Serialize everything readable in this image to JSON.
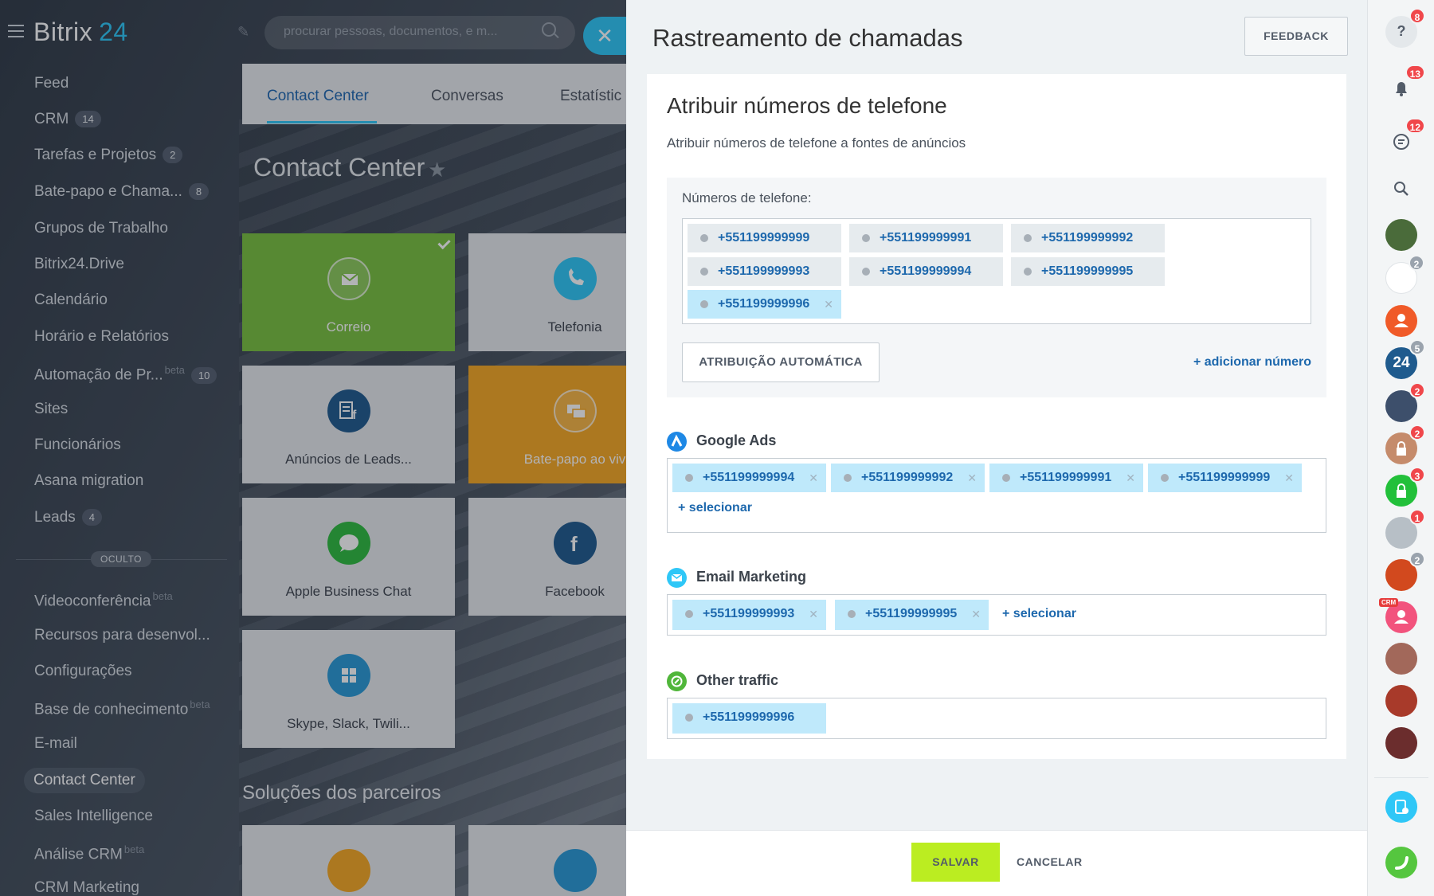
{
  "app": {
    "logo_word": "Bitrix",
    "logo_num": "24"
  },
  "search": {
    "placeholder": "procurar pessoas, documentos, e m..."
  },
  "sidebar": {
    "items": [
      {
        "label": "Feed"
      },
      {
        "label": "CRM",
        "badge": "14"
      },
      {
        "label": "Tarefas e Projetos",
        "badge": "2"
      },
      {
        "label": "Bate-papo e Chama...",
        "badge": "8"
      },
      {
        "label": "Grupos de Trabalho"
      },
      {
        "label": "Bitrix24.Drive"
      },
      {
        "label": "Calendário"
      },
      {
        "label": "Horário e Relatórios"
      },
      {
        "label": "Automação de Pr...",
        "sup": "beta",
        "badge": "10"
      },
      {
        "label": "Sites"
      },
      {
        "label": "Funcionários"
      },
      {
        "label": "Asana migration"
      },
      {
        "label": "Leads",
        "badge": "4"
      }
    ],
    "hidden_label": "OCULTO",
    "hidden_items": [
      {
        "label": "Videoconferência",
        "sup": "beta"
      },
      {
        "label": "Recursos para desenvol..."
      },
      {
        "label": "Configurações"
      },
      {
        "label": "Base de conhecimento",
        "sup": "beta"
      },
      {
        "label": "E-mail"
      },
      {
        "label": "Contact Center",
        "active": true
      },
      {
        "label": "Sales Intelligence"
      },
      {
        "label": "Análise CRM",
        "sup": "beta"
      },
      {
        "label": "CRM Marketing"
      }
    ]
  },
  "contact_center": {
    "tabs": [
      "Contact Center",
      "Conversas",
      "Estatístic"
    ],
    "title": "Contact Center",
    "tiles": [
      {
        "label": "Correio",
        "style": "green",
        "icon": "mail-icon"
      },
      {
        "label": "Telefonia",
        "style": "plain",
        "icon": "phone-icon",
        "color": "#2fc7f7"
      },
      {
        "label": "Anúncios de Leads...",
        "style": "plain",
        "icon": "facebook-leads-icon",
        "color": "#1f5b8e"
      },
      {
        "label": "Bate-papo ao viv",
        "style": "orange",
        "icon": "chat-icon"
      },
      {
        "label": "Apple Business Chat",
        "style": "plain",
        "icon": "apple-chat-icon",
        "color": "#2fbb3f"
      },
      {
        "label": "Facebook",
        "style": "plain",
        "icon": "facebook-icon",
        "color": "#1f5b8e"
      },
      {
        "label": "Skype, Slack, Twili...",
        "style": "plain",
        "icon": "grid-icon",
        "color": "#2a9ad6"
      }
    ],
    "partners_title": "Soluções dos parceiros"
  },
  "panel": {
    "title": "Rastreamento de chamadas",
    "feedback": "FEEDBACK",
    "card_title": "Atribuir números de telefone",
    "card_subtitle": "Atribuir números de telefone a fontes de anúncios",
    "phones_label": "Números de telefone:",
    "phones": [
      {
        "number": "+551199999999"
      },
      {
        "number": "+551199999991"
      },
      {
        "number": "+551199999992"
      },
      {
        "number": "+551199999993"
      },
      {
        "number": "+551199999994"
      },
      {
        "number": "+551199999995"
      },
      {
        "number": "+551199999996",
        "selected": true
      }
    ],
    "auto_button": "ATRIBUIÇÃO AUTOMÁTICA",
    "add_number": "+ adicionar número",
    "sources": [
      {
        "name": "Google Ads",
        "icon": "google-ads-icon",
        "color": "#1e88e5",
        "numbers": [
          "+551199999994",
          "+551199999992",
          "+551199999991",
          "+551199999999"
        ],
        "select": "+ selecionar"
      },
      {
        "name": "Email Marketing",
        "icon": "email-marketing-icon",
        "color": "#2fc7f7",
        "numbers": [
          "+551199999993",
          "+551199999995"
        ],
        "select": "+  selecionar"
      },
      {
        "name": "Other traffic",
        "icon": "other-traffic-icon",
        "color": "#50b63a",
        "numbers": [
          "+551199999996"
        ]
      }
    ],
    "save": "SALVAR",
    "cancel": "CANCELAR"
  },
  "rail": {
    "items": [
      {
        "icon": "help-icon",
        "badge": "8"
      },
      {
        "icon": "bell-icon",
        "badge": "13"
      },
      {
        "icon": "chat-bubble-icon",
        "badge": "12"
      },
      {
        "icon": "search-icon"
      },
      {
        "icon": "avatar-icon",
        "color": "#4a6b3a"
      },
      {
        "icon": "group-avatar-icon",
        "badge": "2",
        "grey": true,
        "color": "#ffffff"
      },
      {
        "icon": "user-icon",
        "color": "#f05a28"
      },
      {
        "icon": "bitrix24-icon",
        "badge": "5",
        "grey": true,
        "color": "#1f5b8e"
      },
      {
        "icon": "avatar-icon",
        "badge": "2",
        "color": "#3d4f6b"
      },
      {
        "icon": "lock-icon",
        "badge": "2",
        "color": "#c58b6b"
      },
      {
        "icon": "lock-icon",
        "badge": "3",
        "color": "#22c03a"
      },
      {
        "icon": "avatar-icon",
        "badge": "1",
        "color": "#b7bfc6"
      },
      {
        "icon": "avatar-icon",
        "badge": "2",
        "grey": true,
        "color": "#d2491e"
      },
      {
        "icon": "user-icon",
        "color": "#f2537d",
        "tag": "CRM"
      },
      {
        "icon": "avatar-icon",
        "color": "#a2685a"
      },
      {
        "icon": "avatar-icon",
        "color": "#a83a2a"
      },
      {
        "icon": "avatar-icon",
        "color": "#6b2d2d"
      }
    ],
    "bottom": [
      {
        "icon": "call-list-icon",
        "color": "#2fc7f7"
      },
      {
        "icon": "phone-call-icon",
        "color": "#55c63f"
      }
    ]
  }
}
